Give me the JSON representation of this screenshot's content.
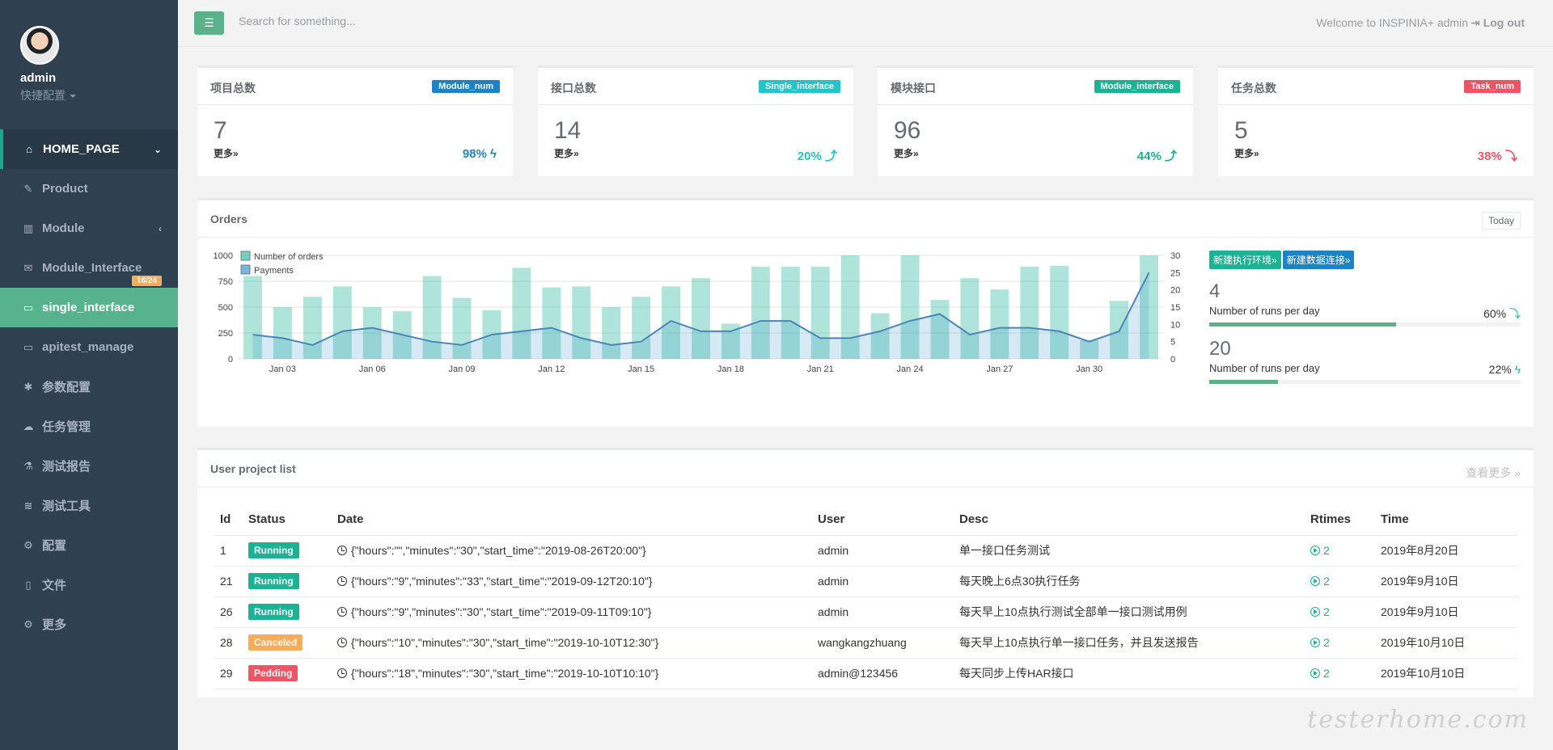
{
  "sidebar": {
    "user": "admin",
    "shortcut": "快捷配置",
    "items": [
      {
        "label": "HOME_PAGE",
        "icon": "home-icon"
      },
      {
        "label": "Product",
        "icon": "edit-icon"
      },
      {
        "label": "Module",
        "icon": "bar-chart-icon"
      },
      {
        "label": "Module_Interface",
        "icon": "envelope-icon",
        "badge": "16/24"
      },
      {
        "label": "single_interface",
        "icon": "folder-open-icon"
      },
      {
        "label": "apitest_manage",
        "icon": "folder-open-icon"
      },
      {
        "label": "参数配置",
        "icon": "asterisk-icon"
      },
      {
        "label": "任务管理",
        "icon": "cloud-icon"
      },
      {
        "label": "测试报告",
        "icon": "flask-icon"
      },
      {
        "label": "测试工具",
        "icon": "database-icon"
      },
      {
        "label": "配置",
        "icon": "gear-icon"
      },
      {
        "label": "文件",
        "icon": "file-icon"
      },
      {
        "label": "更多",
        "icon": "gears-icon"
      }
    ]
  },
  "topbar": {
    "search_placeholder": "Search for something...",
    "welcome": "Welcome to INSPINIA+ admin",
    "logout": "Log out"
  },
  "stats": [
    {
      "title": "项目总数",
      "label": "Module_num",
      "label_color": "#1c84c6",
      "value": "7",
      "more": "更多»",
      "pct": "98%",
      "pct_color": "#1c84c6",
      "arrow": "bolt"
    },
    {
      "title": "接口总数",
      "label": "Single_interface",
      "label_color": "#23c6c8",
      "value": "14",
      "more": "更多»",
      "pct": "20%",
      "pct_color": "#23c6c8",
      "arrow": "up"
    },
    {
      "title": "模块接口",
      "label": "Module_interface",
      "label_color": "#1ab394",
      "value": "96",
      "more": "更多»",
      "pct": "44%",
      "pct_color": "#1ab394",
      "arrow": "up"
    },
    {
      "title": "任务总数",
      "label": "Task_num",
      "label_color": "#ed5565",
      "value": "5",
      "more": "更多»",
      "pct": "38%",
      "pct_color": "#ed5565",
      "arrow": "down"
    }
  ],
  "orders": {
    "title": "Orders",
    "today": "Today",
    "buttons": [
      "新建执行环境»",
      "新建数据连接»"
    ],
    "mini": [
      {
        "value": "4",
        "label": "Number of runs per day",
        "pct": "60%",
        "arrow": "down",
        "fill": 0.6
      },
      {
        "value": "20",
        "label": "Number of runs per day",
        "pct": "22%",
        "arrow": "bolt",
        "fill": 0.22
      }
    ]
  },
  "chart_data": {
    "type": "bar",
    "categories": [
      "Jan 02",
      "Jan 03",
      "Jan 04",
      "Jan 05",
      "Jan 06",
      "Jan 07",
      "Jan 08",
      "Jan 09",
      "Jan 10",
      "Jan 11",
      "Jan 12",
      "Jan 13",
      "Jan 14",
      "Jan 15",
      "Jan 16",
      "Jan 17",
      "Jan 18",
      "Jan 19",
      "Jan 20",
      "Jan 21",
      "Jan 22",
      "Jan 23",
      "Jan 24",
      "Jan 25",
      "Jan 26",
      "Jan 27",
      "Jan 28",
      "Jan 29",
      "Jan 30",
      "Jan 31"
    ],
    "tick_labels": [
      "Jan 03",
      "Jan 06",
      "Jan 09",
      "Jan 12",
      "Jan 15",
      "Jan 18",
      "Jan 21",
      "Jan 24",
      "Jan 27",
      "Jan 30"
    ],
    "series": [
      {
        "name": "Number of orders",
        "axis": "left",
        "color": "#1ab394",
        "values": [
          800,
          500,
          600,
          700,
          500,
          460,
          800,
          590,
          470,
          880,
          690,
          700,
          500,
          600,
          700,
          780,
          340,
          890,
          890,
          890,
          1000,
          440,
          1000,
          570,
          780,
          670,
          890,
          900,
          180,
          560,
          1000
        ]
      },
      {
        "name": "Payments",
        "axis": "right",
        "color": "#1c84c6",
        "values": [
          7,
          6,
          4,
          8,
          9,
          7,
          5,
          4,
          7,
          8,
          9,
          6,
          4,
          5,
          11,
          8,
          8,
          11,
          11,
          6,
          6,
          8,
          11,
          13,
          7,
          9,
          9,
          8,
          5,
          8,
          25
        ]
      }
    ],
    "ylim_left": [
      0,
      1000
    ],
    "yticks_left": [
      0,
      250,
      500,
      750,
      1000
    ],
    "ylim_right": [
      0,
      30
    ],
    "yticks_right": [
      0,
      5,
      10,
      15,
      20,
      25,
      30
    ],
    "legend": "top-left",
    "grid": true
  },
  "projects": {
    "title": "User project list",
    "view_more": "查看更多",
    "columns": [
      "Id",
      "Status",
      "Date",
      "User",
      "Desc",
      "Rtimes",
      "Time"
    ],
    "rows": [
      {
        "id": "1",
        "status": "Running",
        "status_color": "#1ab394",
        "date": "{\"hours\":\"\",\"minutes\":\"30\",\"start_time\":\"2019-08-26T20:00\"}",
        "user": "admin",
        "desc": "单一接口任务测试",
        "rtimes": "2",
        "time": "2019年8月20日"
      },
      {
        "id": "21",
        "status": "Running",
        "status_color": "#1ab394",
        "date": "{\"hours\":\"9\",\"minutes\":\"33\",\"start_time\":\"2019-09-12T20:10\"}",
        "user": "admin",
        "desc": "每天晚上6点30执行任务",
        "rtimes": "2",
        "time": "2019年9月10日"
      },
      {
        "id": "26",
        "status": "Running",
        "status_color": "#1ab394",
        "date": "{\"hours\":\"9\",\"minutes\":\"30\",\"start_time\":\"2019-09-11T09:10\"}",
        "user": "admin",
        "desc": "每天早上10点执行测试全部单一接口测试用例",
        "rtimes": "2",
        "time": "2019年9月10日"
      },
      {
        "id": "28",
        "status": "Canceled",
        "status_color": "#f8ac59",
        "date": "{\"hours\":\"10\",\"minutes\":\"30\",\"start_time\":\"2019-10-10T12:30\"}",
        "user": "wangkangzhuang",
        "desc": "每天早上10点执行单一接口任务，并且发送报告",
        "rtimes": "2",
        "time": "2019年10月10日"
      },
      {
        "id": "29",
        "status": "Pedding",
        "status_color": "#ed5565",
        "date": "{\"hours\":\"18\",\"minutes\":\"30\",\"start_time\":\"2019-10-10T10:10\"}",
        "user": "admin@123456",
        "desc": "每天同步上传HAR接口",
        "rtimes": "2",
        "time": "2019年10月10日"
      }
    ]
  },
  "watermark": "testerhome.com"
}
